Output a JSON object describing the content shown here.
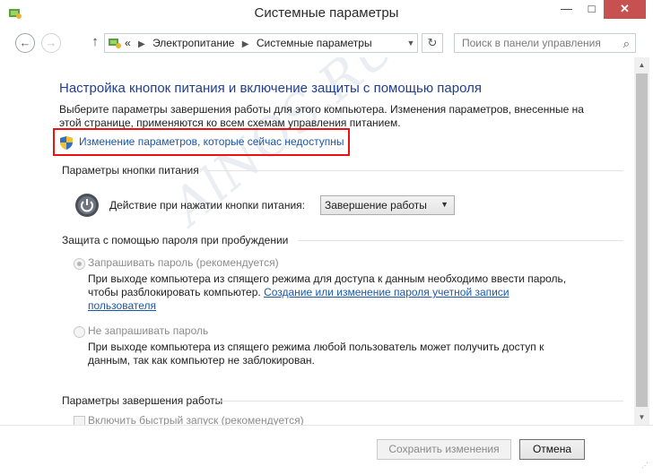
{
  "window": {
    "title": "Системные параметры",
    "controls": {
      "minimize": "—",
      "maximize": "□",
      "close": "✕"
    }
  },
  "navigation": {
    "back_icon": "back-arrow-icon",
    "forward_icon": "forward-arrow-icon",
    "up_icon": "up-arrow-icon",
    "address_prefix": "«",
    "breadcrumbs": [
      "Электропитание",
      "Системные параметры"
    ],
    "search_placeholder": "Поиск в панели управления"
  },
  "content": {
    "heading": "Настройка кнопок питания и включение защиты с помощью пароля",
    "description": "Выберите параметры завершения работы для этого компьютера. Изменения параметров, внесенные на этой странице, применяются ко всем схемам управления питанием.",
    "change_link": "Изменение параметров, которые сейчас недоступны",
    "power_section": {
      "title": "Параметры кнопки питания",
      "action_label": "Действие при нажатии кнопки питания:",
      "action_value": "Завершение работы"
    },
    "password_section": {
      "title": "Защита с помощью пароля при пробуждении",
      "option1_label": "Запрашивать пароль (рекомендуется)",
      "option1_desc": "При выходе компьютера из спящего режима для доступа к данным необходимо ввести пароль, чтобы разблокировать компьютер.",
      "option1_link": "Создание или изменение пароля учетной записи пользователя",
      "option2_label": "Не запрашивать пароль",
      "option2_desc": "При выходе компьютера из спящего режима любой пользователь может получить доступ к данным, так как компьютер не заблокирован.",
      "selected": "option1"
    },
    "shutdown_section": {
      "title": "Параметры завершения работы",
      "fast_startup_label": "Включить быстрый запуск (рекомендуется)"
    },
    "watermark": "AlNOS.RU"
  },
  "footer": {
    "save_label": "Сохранить изменения",
    "cancel_label": "Отмена"
  },
  "colors": {
    "heading": "#1f3f92",
    "link": "#1c57a6",
    "highlight_border": "#ee1111",
    "close_button": "#c75050"
  }
}
